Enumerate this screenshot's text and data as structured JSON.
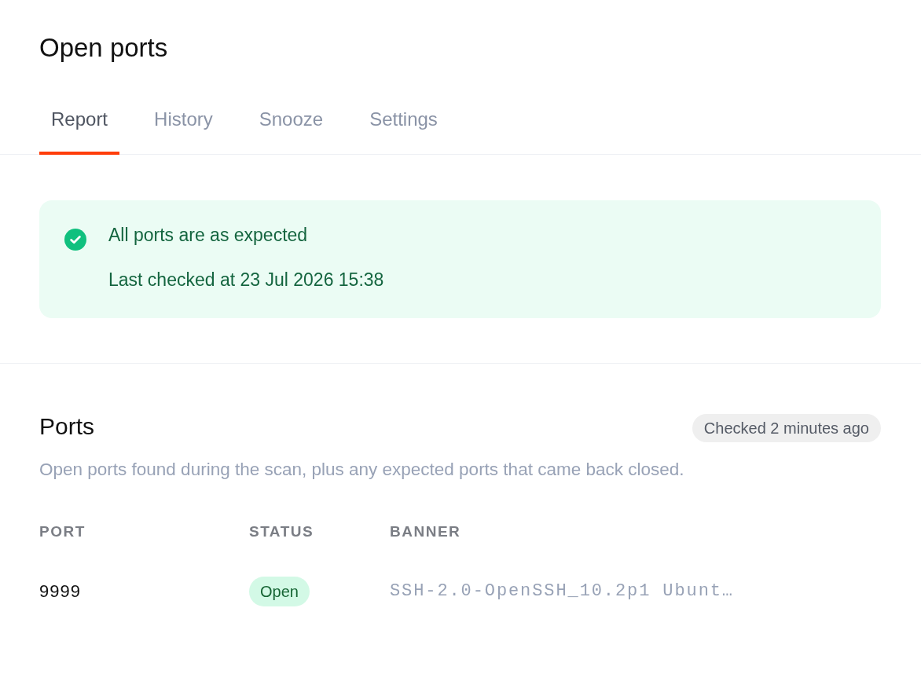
{
  "page": {
    "title": "Open ports"
  },
  "tabs": [
    {
      "label": "Report",
      "selected": true
    },
    {
      "label": "History",
      "selected": false
    },
    {
      "label": "Snooze",
      "selected": false
    },
    {
      "label": "Settings",
      "selected": false
    }
  ],
  "alert": {
    "kind": "success",
    "title": "All ports are as expected",
    "detail": "Last checked at 23 Jul 2026 15:38"
  },
  "ports_section": {
    "title": "Ports",
    "badge": "Checked 2 minutes ago",
    "description": "Open ports found during the scan, plus any expected ports that came back closed.",
    "table": {
      "columns": [
        "PORT",
        "STATUS",
        "BANNER"
      ],
      "rows": [
        {
          "port": "9999",
          "status": {
            "label": "Open",
            "kind": "open"
          },
          "banner": "SSH-2.0-OpenSSH_10.2p1 Ubunt…"
        }
      ]
    }
  }
}
